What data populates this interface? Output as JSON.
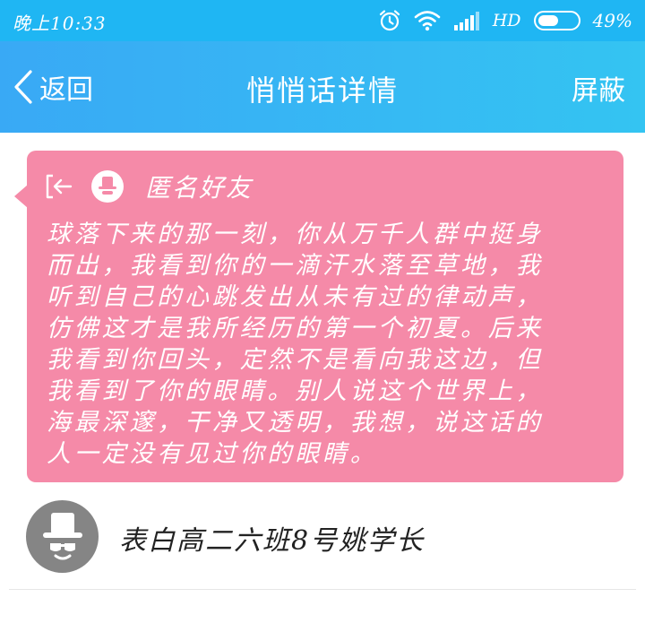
{
  "status_bar": {
    "time": "晚上10:33",
    "network_label": "HD",
    "battery": "49%",
    "battery_level": 0.49,
    "icons": [
      "alarm-icon",
      "wifi-icon",
      "signal-icon",
      "battery-icon"
    ]
  },
  "nav": {
    "back_label": "返回",
    "title": "悄悄话详情",
    "block_label": "屏蔽"
  },
  "message": {
    "sender": "匿名好友",
    "body": "球落下来的那一刻，你从万千人群中挺身\n而出，我看到你的一滴汗水落至草地，我\n听到自己的心跳发出从未有过的律动声，\n仿佛这才是我所经历的第一个初夏。后来\n我看到你回头，定然不是看向我这边，但\n我看到了你的眼睛。别人说这个世界上，\n海最深邃，干净又透明，我想，说这话的\n人一定没有见过你的眼睛。",
    "bubble_color": "#f58aa8"
  },
  "recipient": {
    "text": "表白高二六班8号姚学长"
  },
  "colors": {
    "status_bar": "#1fb6f3",
    "nav_start": "#39a9f5",
    "nav_end": "#34c4f2",
    "avatar_bg": "#858585"
  }
}
